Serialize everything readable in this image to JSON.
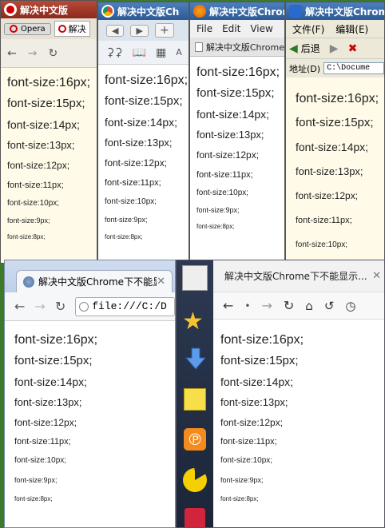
{
  "opera": {
    "title": "解决中文版",
    "tab_label": "Opera",
    "tab2_label": "解决"
  },
  "chrome_small": {
    "title": "解决中文版Ch"
  },
  "firefox": {
    "title": "解决中文版Chrome",
    "menu": [
      "File",
      "Edit",
      "View"
    ],
    "tab_label": "解决中文版Chrome"
  },
  "ie": {
    "title": "解决中文版Chrome",
    "menu": [
      "文件(F)",
      "编辑(E)"
    ],
    "back_label": "后退",
    "address_label": "地址(D)",
    "address_value": "C:\\Docume"
  },
  "chrome_large": {
    "tab_title": "解决中文版Chrome下不能显",
    "address": "file:///C:/D"
  },
  "rockmelt": {
    "tab_title": "解决中文版Chrome下不能显示..."
  },
  "font_lines": {
    "opera": [
      "font-size:16px;",
      "font-size:15px;",
      "font-size:14px;",
      "font-size:13px;",
      "font-size:12px;",
      "font-size:11px;",
      "font-size:10px;",
      "font-size:9px;",
      "font-size:8px;"
    ],
    "chrome_small": [
      "font-size:16px;",
      "font-size:15px;",
      "font-size:14px;",
      "font-size:13px;",
      "font-size:12px;",
      "font-size:11px;",
      "font-size:10px;",
      "font-size:9px;",
      "font-size:8px;"
    ],
    "firefox": [
      "font-size:16px;",
      "font-size:15px;",
      "font-size:14px;",
      "font-size:13px;",
      "font-size:12px;",
      "font-size:11px;",
      "font-size:10px;",
      "font-size:9px;",
      "font-size:8px;"
    ],
    "ie": [
      "font-size:16px;",
      "font-size:15px;",
      "font-size:14px;",
      "font-size:13px;",
      "font-size:12px;",
      "font-size:11px;",
      "font-size:10px;"
    ],
    "chrome_large": [
      "font-size:16px;",
      "font-size:15px;",
      "font-size:14px;",
      "font-size:13px;",
      "font-size:12px;",
      "font-size:11px;",
      "font-size:10px;",
      "font-size:9px;",
      "font-size:8px;"
    ],
    "rockmelt": [
      "font-size:16px;",
      "font-size:15px;",
      "font-size:14px;",
      "font-size:13px;",
      "font-size:12px;",
      "font-size:11px;",
      "font-size:10px;",
      "font-size:9px;",
      "font-size:8px;"
    ]
  }
}
